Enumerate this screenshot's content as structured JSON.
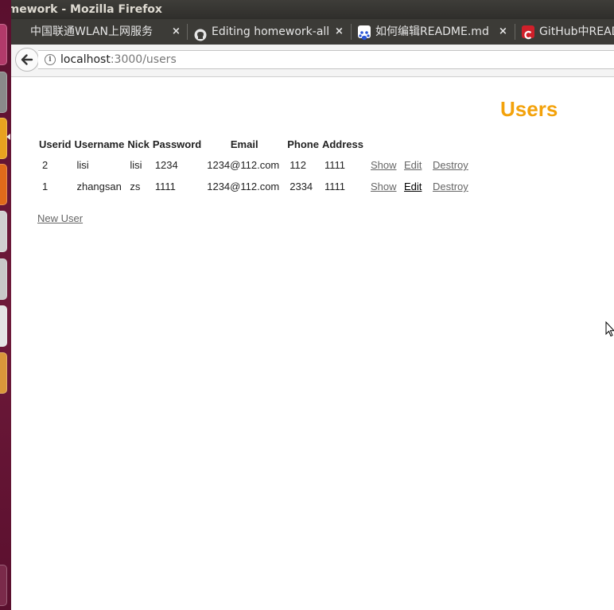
{
  "window": {
    "title": "omework - Mozilla Firefox"
  },
  "tabs": [
    {
      "label": "中国联通WLAN上网服务",
      "icon": "none",
      "close": "×"
    },
    {
      "label": "Editing homework-all",
      "icon": "github-icon",
      "close": "×"
    },
    {
      "label": "如何编辑README.md",
      "icon": "baidu-paw-icon",
      "close": "×"
    },
    {
      "label": "GitHub中README",
      "icon": "csdn-icon",
      "close": ""
    }
  ],
  "navbar": {
    "url_host": "localhost",
    "url_path": ":3000/users"
  },
  "page": {
    "title": "Users",
    "title_color": "#f3a20b",
    "columns": [
      "Userid",
      "Username",
      "Nick",
      "Password",
      "Email",
      "Phone",
      "Address"
    ],
    "rows": [
      {
        "userid": "2",
        "username": "lisi",
        "nick": "lisi",
        "password": "1234",
        "email": "1234@112.com",
        "phone": "112",
        "address": "1111",
        "show": "Show",
        "edit": "Edit",
        "destroy": "Destroy"
      },
      {
        "userid": "1",
        "username": "zhangsan",
        "nick": "zs",
        "password": "1111",
        "email": "1234@112.com",
        "phone": "2334",
        "address": "1111",
        "show": "Show",
        "edit": "Edit",
        "destroy": "Destroy"
      }
    ],
    "new_user_link": "New User"
  },
  "colors": {
    "launcher": "#6e1a3a",
    "titlebar": "#3c3b37",
    "link": "#666666"
  }
}
